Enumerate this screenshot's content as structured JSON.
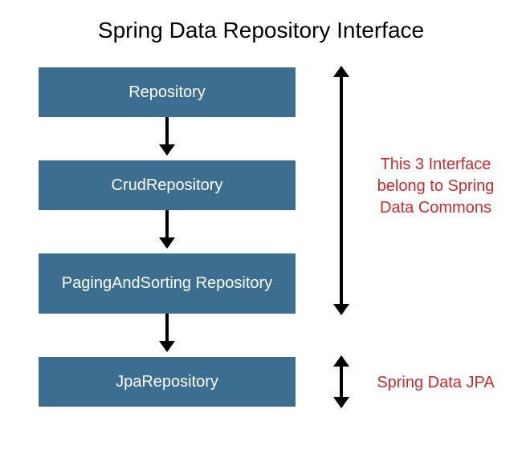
{
  "title": "Spring Data Repository Interface",
  "boxes": {
    "repository": "Repository",
    "crud": "CrudRepository",
    "paging": "PagingAndSorting Repository",
    "jpa": "JpaRepository"
  },
  "annotations": {
    "commons": "This 3 Interface belong to Spring Data Commons",
    "jpa": "Spring Data JPA"
  },
  "colors": {
    "box_bg": "#3b6e8f",
    "annot_color": "#cc2a2a"
  }
}
